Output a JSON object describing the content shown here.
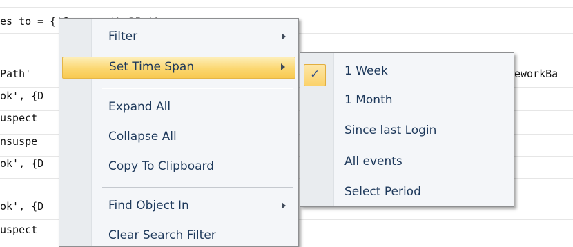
{
  "background": {
    "line1": "es to = {'C",
    "line1_tail": "th 35+'}",
    "header_left": " Path'",
    "header_right": "eworkBa",
    "rows": [
      "ok', {D",
      "uspect",
      "nsuspe",
      "ok', {D",
      "ok', {D",
      "uspect"
    ]
  },
  "menu": {
    "items": [
      {
        "label": "Filter",
        "submenu": true
      },
      {
        "label": "Set Time Span",
        "submenu": true
      },
      {
        "label": "Expand All",
        "submenu": false
      },
      {
        "label": "Collapse All",
        "submenu": false
      },
      {
        "label": "Copy To Clipboard",
        "submenu": false
      },
      {
        "label": "Find Object In",
        "submenu": true
      },
      {
        "label": "Clear Search Filter",
        "submenu": false
      }
    ],
    "highlighted": "Set Time Span"
  },
  "submenu": {
    "items": [
      {
        "label": "1 Week",
        "checked": true
      },
      {
        "label": "1 Month",
        "checked": false
      },
      {
        "label": "Since last Login",
        "checked": false
      },
      {
        "label": "All events",
        "checked": false
      },
      {
        "label": "Select Period",
        "checked": false
      }
    ],
    "check_glyph": "✓"
  },
  "colors": {
    "menu_text": "#1e395b",
    "highlight": "#fbd771",
    "check": "#2b4a8a"
  }
}
